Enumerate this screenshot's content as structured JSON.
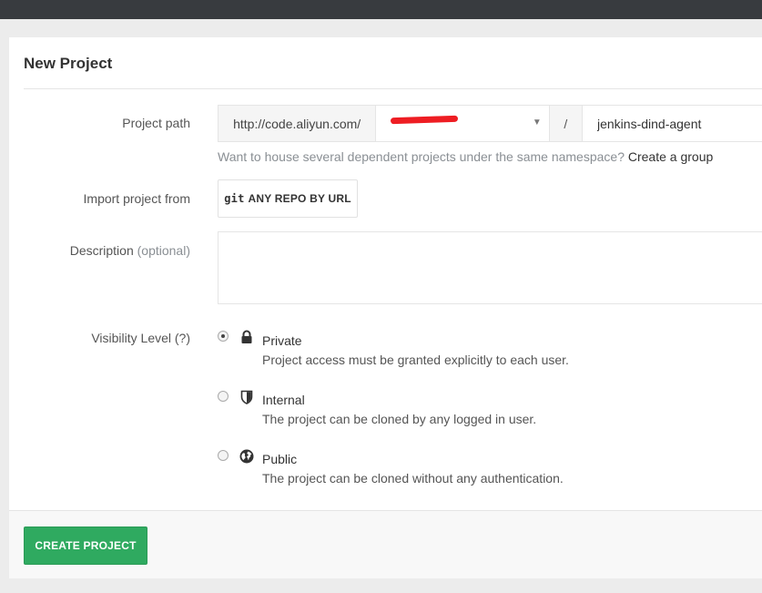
{
  "page": {
    "title": "New Project"
  },
  "project_path": {
    "label": "Project path",
    "prefix": "http://code.aliyun.com/",
    "separator": "/",
    "name_value": "jenkins-dind-agent"
  },
  "help": {
    "text": "Want to house several dependent projects under the same namespace?",
    "link": "Create a group"
  },
  "import": {
    "label": "Import project from",
    "git_glyph": "git",
    "button_label": "ANY REPO BY URL"
  },
  "description": {
    "label": "Description",
    "optional": "(optional)",
    "value": ""
  },
  "visibility": {
    "label": "Visibility Level (?)",
    "options": [
      {
        "title": "Private",
        "desc": "Project access must be granted explicitly to each user.",
        "icon": "lock-icon",
        "checked": true
      },
      {
        "title": "Internal",
        "desc": "The project can be cloned by any logged in user.",
        "icon": "shield-icon",
        "checked": false
      },
      {
        "title": "Public",
        "desc": "The project can be cloned without any authentication.",
        "icon": "globe-icon",
        "checked": false
      }
    ]
  },
  "footer": {
    "create_label": "CREATE PROJECT"
  },
  "colors": {
    "accent_green": "#2faa60",
    "topbar": "#383b3f",
    "redaction": "#ee1d23"
  }
}
